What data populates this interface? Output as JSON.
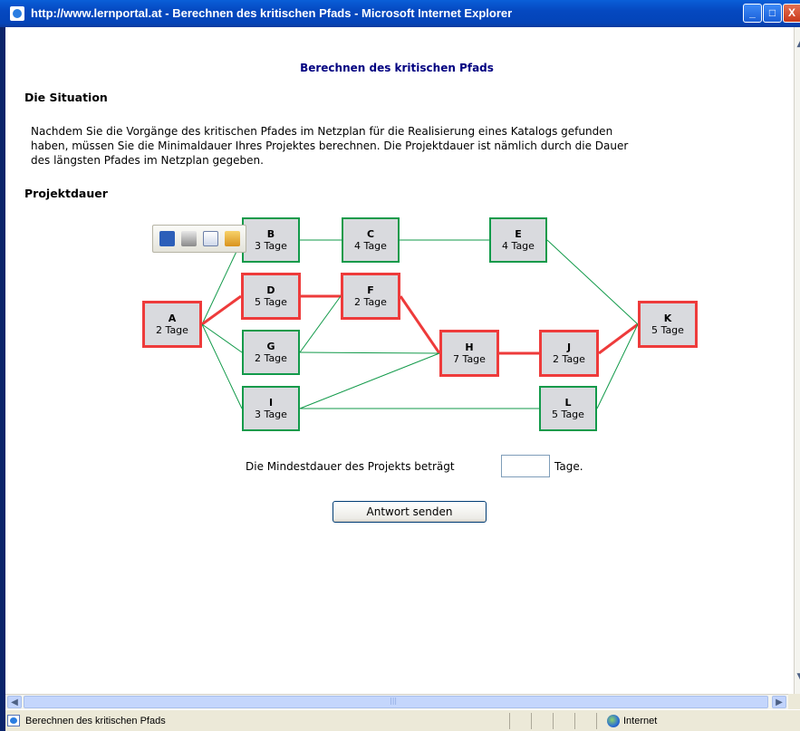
{
  "window": {
    "title": "http://www.lernportal.at - Berechnen des kritischen Pfads - Microsoft Internet Explorer",
    "minimize": "_",
    "maximize": "□",
    "close": "X"
  },
  "page": {
    "title": "Berechnen des kritischen Pfads",
    "situation_heading": "Die Situation",
    "situation_lines": [
      "Nachdem Sie die Vorgänge des kritischen Pfades im Netzplan für die Realisierung eines Katalogs gefunden",
      "haben, müssen Sie die Minimaldauer Ihres Projektes berechnen. Die Projektdauer ist nämlich durch die Dauer",
      "des längsten Pfades im Netzplan gegeben."
    ],
    "project_heading": "Projektdauer"
  },
  "network": {
    "critical_color": "#ee3b3b",
    "normal_color": "#129a4a",
    "nodes": {
      "A": {
        "label": "A",
        "duration": "2 Tage",
        "critical": true
      },
      "B": {
        "label": "B",
        "duration": "3 Tage",
        "critical": false
      },
      "C": {
        "label": "C",
        "duration": "4 Tage",
        "critical": false
      },
      "D": {
        "label": "D",
        "duration": "5 Tage",
        "critical": true
      },
      "E": {
        "label": "E",
        "duration": "4 Tage",
        "critical": false
      },
      "F": {
        "label": "F",
        "duration": "2 Tage",
        "critical": true
      },
      "G": {
        "label": "G",
        "duration": "2 Tage",
        "critical": false
      },
      "H": {
        "label": "H",
        "duration": "7 Tage",
        "critical": true
      },
      "I": {
        "label": "I",
        "duration": "3 Tage",
        "critical": false
      },
      "J": {
        "label": "J",
        "duration": "2 Tage",
        "critical": true
      },
      "K": {
        "label": "K",
        "duration": "5 Tage",
        "critical": true
      },
      "L": {
        "label": "L",
        "duration": "5 Tage",
        "critical": false
      }
    },
    "edges": [
      {
        "from": "A",
        "to": "B",
        "critical": false
      },
      {
        "from": "A",
        "to": "D",
        "critical": true
      },
      {
        "from": "A",
        "to": "G",
        "critical": false
      },
      {
        "from": "A",
        "to": "I",
        "critical": false
      },
      {
        "from": "B",
        "to": "C",
        "critical": false
      },
      {
        "from": "C",
        "to": "E",
        "critical": false
      },
      {
        "from": "D",
        "to": "F",
        "critical": true
      },
      {
        "from": "G",
        "to": "F",
        "critical": false
      },
      {
        "from": "G",
        "to": "H",
        "critical": false
      },
      {
        "from": "F",
        "to": "H",
        "critical": true
      },
      {
        "from": "I",
        "to": "H",
        "critical": false
      },
      {
        "from": "I",
        "to": "L",
        "critical": false
      },
      {
        "from": "H",
        "to": "J",
        "critical": true
      },
      {
        "from": "J",
        "to": "K",
        "critical": true
      },
      {
        "from": "E",
        "to": "K",
        "critical": false
      },
      {
        "from": "L",
        "to": "K",
        "critical": false
      }
    ]
  },
  "image_toolbar": {
    "icons": [
      "save-icon",
      "print-icon",
      "email-icon",
      "my-pictures-icon"
    ]
  },
  "question": {
    "label": "Die Mindestdauer des Projekts beträgt",
    "unit": "Tage.",
    "value": ""
  },
  "submit_label": "Antwort senden",
  "statusbar": {
    "text": "Berechnen des kritischen Pfads",
    "zone": "Internet"
  }
}
